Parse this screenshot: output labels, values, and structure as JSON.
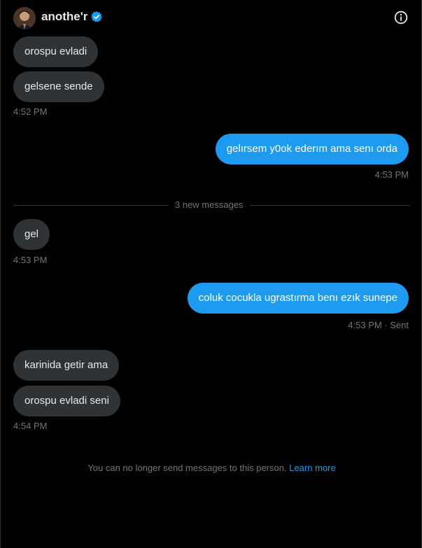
{
  "header": {
    "name": "anothe'r",
    "avatar_icon": "user-avatar",
    "verified_icon": "verified-badge-icon",
    "info_icon": "info-icon"
  },
  "messages": [
    {
      "text": "orospu evladi",
      "direction": "in"
    },
    {
      "text": "gelsene sende",
      "direction": "in"
    },
    {
      "time": "4:52 PM"
    },
    {
      "text": "gelırsem y0ok ederım ama senı orda",
      "direction": "out"
    },
    {
      "time": "4:53 PM"
    },
    {
      "text": "gel",
      "direction": "in"
    },
    {
      "time": "4:53 PM"
    },
    {
      "text": "coluk cocukla ugrastırma benı ezık sunepe",
      "direction": "out"
    },
    {
      "time": "4:53 PM · Sent"
    },
    {
      "text": "karinida getir ama",
      "direction": "in"
    },
    {
      "text": "orospu evladi seni",
      "direction": "in"
    },
    {
      "time": "4:54 PM"
    }
  ],
  "divider": {
    "label": "3 new messages"
  },
  "notice": {
    "text": "You can no longer send messages to this person.",
    "link": "Learn more"
  },
  "colors": {
    "incoming_bubble": "#2f3336",
    "outgoing_bubble": "#1d9bf0",
    "link": "#1d9bf0",
    "muted": "#71767b"
  }
}
